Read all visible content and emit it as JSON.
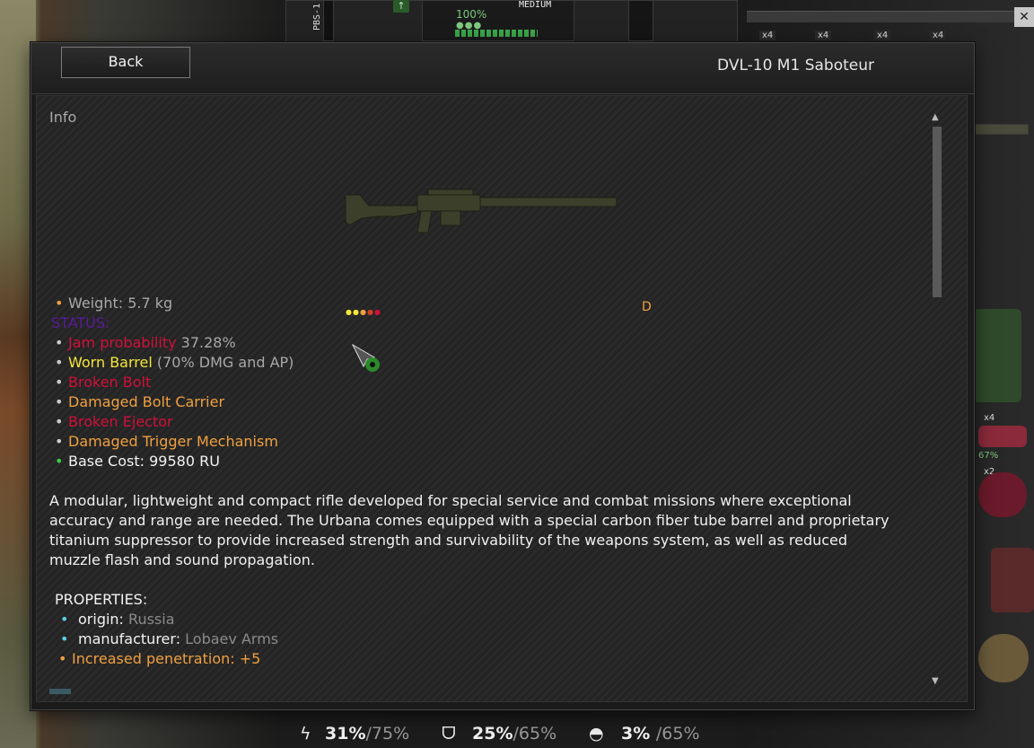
{
  "top_strip": {
    "weapon_tag": "PBS-1",
    "upgrade_arrow": "↑",
    "condition": "100%",
    "condition_dots": "●●●",
    "armor_class": "MEDIUM"
  },
  "inventory": {
    "ammo": [
      {
        "count": "x4"
      },
      {
        "count": "x4"
      },
      {
        "count": "x4"
      },
      {
        "count": "x4"
      }
    ],
    "meat_count": "x4",
    "meat_condition": "67%",
    "bandage_count": "x2"
  },
  "dialog": {
    "back_label": "Back",
    "title": "DVL-10 M1 Saboteur",
    "section_label": "Info",
    "rarity_dots": "●●●●●",
    "grade": "D",
    "stats": [
      {
        "bullet": "•",
        "label": "Weight: 5.7 kg",
        "rest": ""
      },
      {
        "bullet": "",
        "label": "STATUS:",
        "rest": ""
      },
      {
        "bullet": "•",
        "label": "Jam probability",
        "rest": " 37.28%"
      },
      {
        "bullet": "•",
        "label": "Worn Barrel",
        "rest": " (70% DMG and AP)"
      },
      {
        "bullet": "•",
        "label": "Broken Bolt",
        "rest": ""
      },
      {
        "bullet": "•",
        "label": "Damaged Bolt Carrier",
        "rest": ""
      },
      {
        "bullet": "•",
        "label": "Broken Ejector",
        "rest": ""
      },
      {
        "bullet": "•",
        "label": "Damaged Trigger Mechanism",
        "rest": ""
      },
      {
        "bullet": "•",
        "label": "Base Cost: 99580 RU",
        "rest": ""
      }
    ],
    "description": "A modular, lightweight and compact rifle developed for special service and combat missions where exceptional accuracy and range are needed. The Urbana comes equipped with a special carbon fiber tube barrel and proprietary titanium suppressor to provide increased strength and survivability of the weapons system, as well as reduced muzzle flash and sound propagation.",
    "properties_header": "PROPERTIES:",
    "properties": [
      {
        "bullet": "•",
        "key": "origin:",
        "value": "Russia"
      },
      {
        "bullet": "•",
        "key": "manufacturer:",
        "value": "Lobaev Arms"
      }
    ],
    "bonus": {
      "bullet": "•",
      "text": "Increased penetration: +5"
    }
  },
  "status_bar": {
    "stamina": "31%",
    "stamina_max": "/75%",
    "jaw": "25%",
    "jaw_max": "/65%",
    "helmet": "3%",
    "helmet_max": "/65%"
  },
  "colors": {
    "orange": "#f0a040",
    "crimson": "#d0103a",
    "yellow": "#f2e63a",
    "purple": "#5a1a9a",
    "gray_text": "#a8a8a8",
    "white_text": "#f2f2f2",
    "green_bullet": "#3ad04a",
    "cyan_bullet": "#5ad0e6"
  }
}
